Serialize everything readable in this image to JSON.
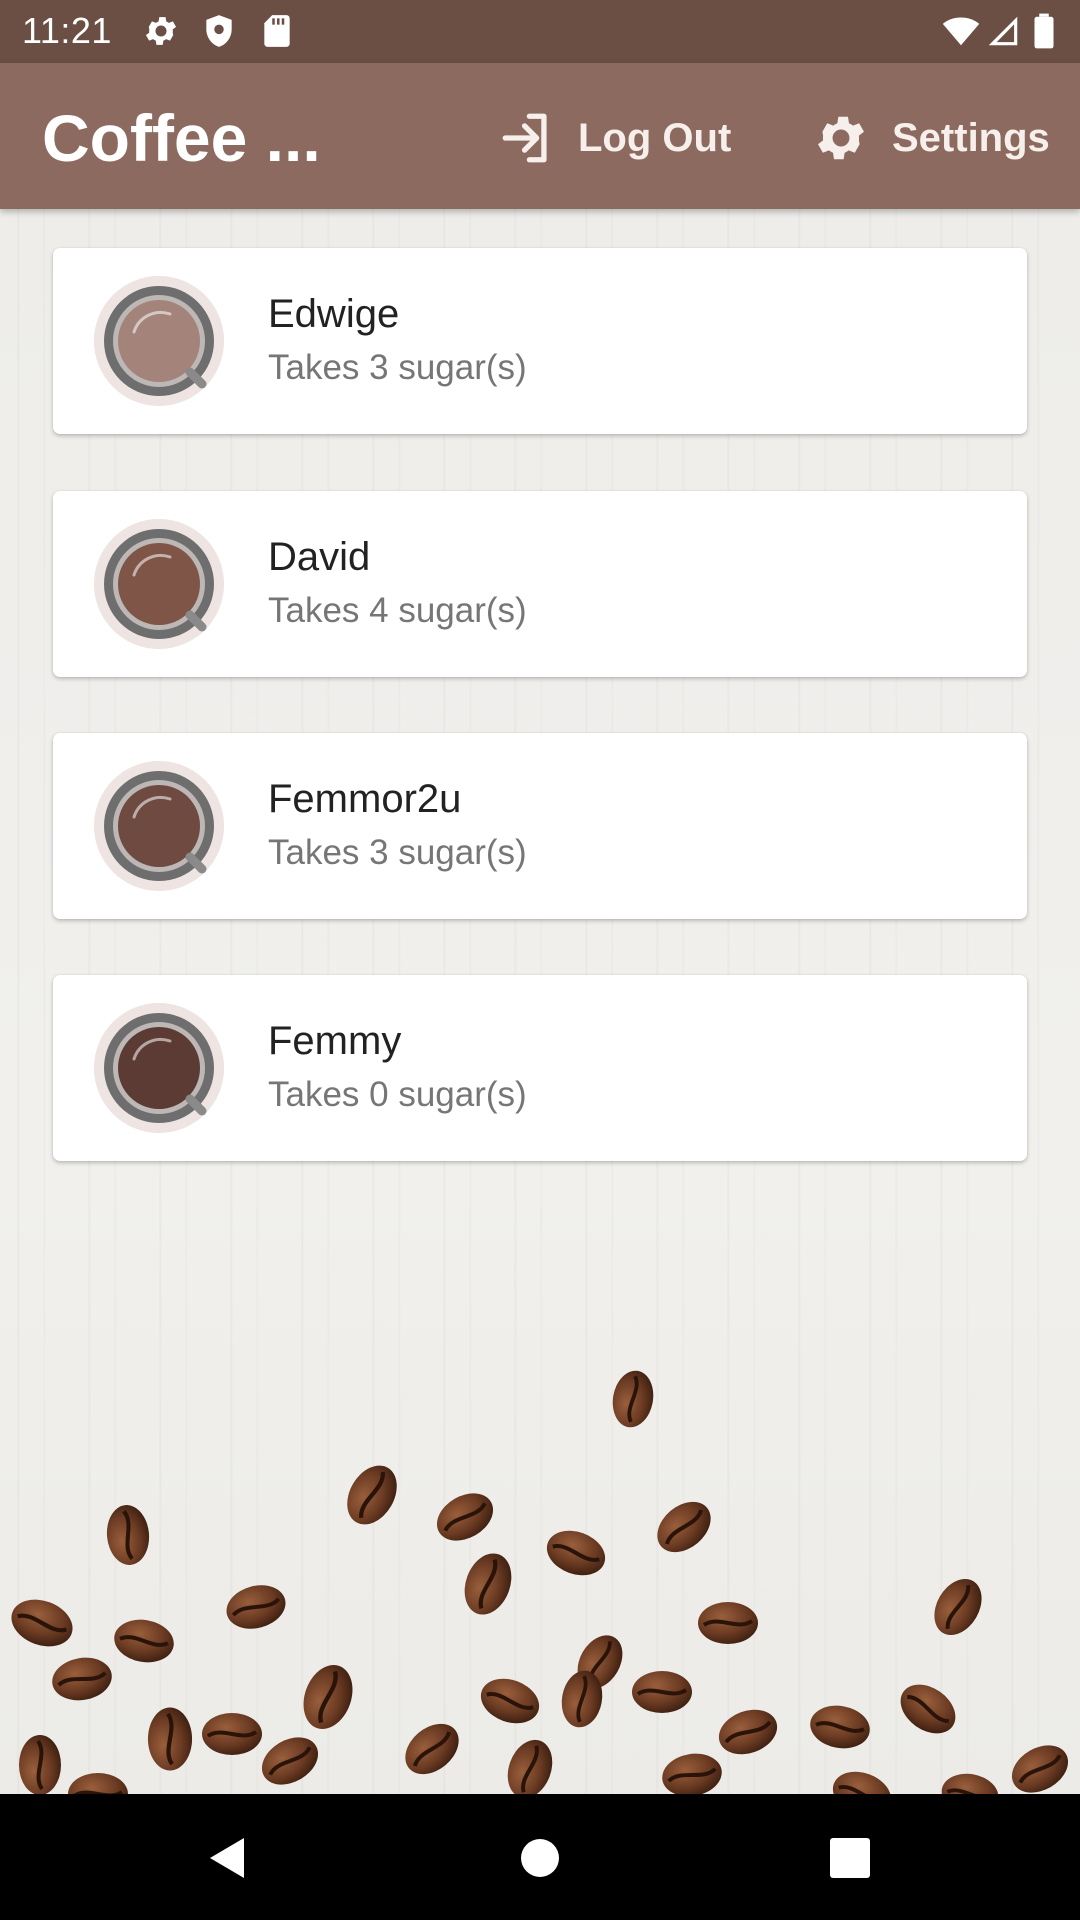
{
  "status_bar": {
    "time": "11:21",
    "left_icons": [
      "gear-icon",
      "shield-icon",
      "sd-card-icon"
    ],
    "right_icons": [
      "wifi-icon",
      "signal-icon",
      "battery-icon"
    ]
  },
  "app_bar": {
    "title": "Coffee ...",
    "actions": [
      {
        "label": "Log Out",
        "icon": "logout-icon"
      },
      {
        "label": "Settings",
        "icon": "gear-icon"
      }
    ]
  },
  "people": [
    {
      "name": "Edwige",
      "subtitle": "Takes 3 sugar(s)",
      "coffee_color": "#a3837a"
    },
    {
      "name": "David",
      "subtitle": "Takes 4 sugar(s)",
      "coffee_color": "#7e5547"
    },
    {
      "name": "Femmor2u",
      "subtitle": "Takes 3 sugar(s)",
      "coffee_color": "#6e4a40"
    },
    {
      "name": "Femmy",
      "subtitle": "Takes 0 sugar(s)",
      "coffee_color": "#5b3b33"
    }
  ],
  "nav_bar": {
    "buttons": [
      "back-icon",
      "home-icon",
      "recents-icon"
    ]
  },
  "colors": {
    "status_bar": "#6b4f45",
    "app_bar": "#8d6a5f",
    "card_background": "#ffffff",
    "avatar_background": "#eee5e2",
    "mug_rim": "#6e6e6e"
  }
}
